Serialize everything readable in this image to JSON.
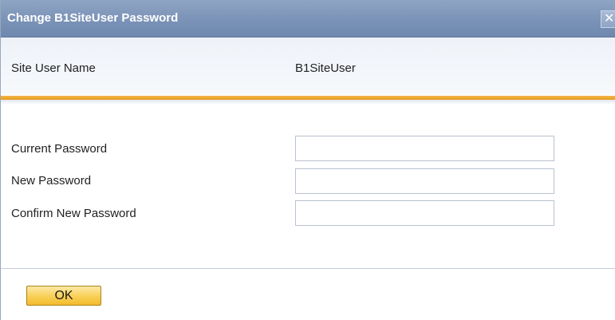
{
  "window": {
    "title": "Change B1SiteUser Password",
    "close_icon_glyph": "✕"
  },
  "site_user": {
    "label": "Site User Name",
    "value": "B1SiteUser"
  },
  "form": {
    "current_password": {
      "label": "Current Password",
      "value": ""
    },
    "new_password": {
      "label": "New Password",
      "value": ""
    },
    "confirm_password": {
      "label": "Confirm New Password",
      "value": ""
    }
  },
  "buttons": {
    "ok_label": "OK"
  },
  "colors": {
    "title_bar": "#7c94b8",
    "accent_orange": "#e89a1c",
    "ok_button": "#f9cf55"
  }
}
